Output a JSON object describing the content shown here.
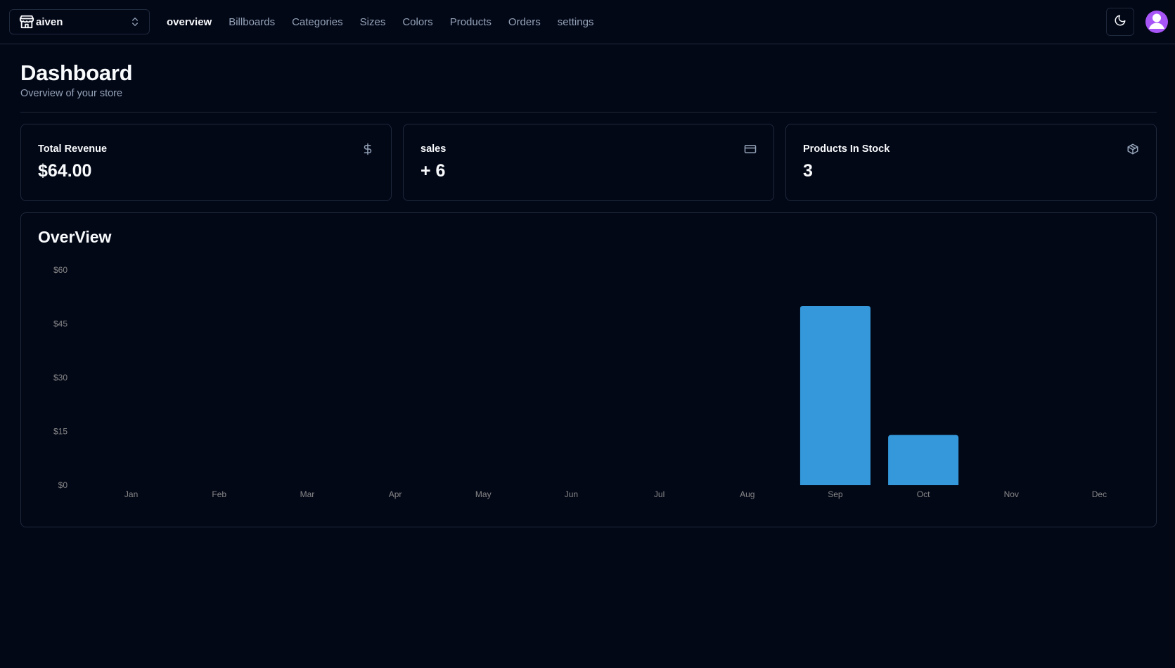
{
  "header": {
    "store_name": "aiven",
    "store_icon": "store-icon",
    "switcher_icon": "chevrons-up-down-icon",
    "nav": [
      {
        "label": "overview",
        "active": true
      },
      {
        "label": "Billboards",
        "active": false
      },
      {
        "label": "Categories",
        "active": false
      },
      {
        "label": "Sizes",
        "active": false
      },
      {
        "label": "Colors",
        "active": false
      },
      {
        "label": "Products",
        "active": false
      },
      {
        "label": "Orders",
        "active": false
      },
      {
        "label": "settings",
        "active": false
      }
    ],
    "theme_icon": "moon-icon",
    "avatar_icon": "user-avatar-icon"
  },
  "page": {
    "title": "Dashboard",
    "subtitle": "Overview of your store"
  },
  "stats": [
    {
      "label": "Total Revenue",
      "value": "$64.00",
      "icon": "dollar-sign-icon"
    },
    {
      "label": "sales",
      "value": "+ 6",
      "icon": "credit-card-icon"
    },
    {
      "label": "Products In Stock",
      "value": "3",
      "icon": "package-icon"
    }
  ],
  "overview": {
    "title": "OverView"
  },
  "colors": {
    "background": "#030817",
    "border": "#1e293b",
    "bar": "#3498db",
    "muted_text": "#94a3b8",
    "axis_text": "#888888",
    "avatar": "#a855f7"
  },
  "chart_data": {
    "type": "bar",
    "title": "OverView",
    "categories": [
      "Jan",
      "Feb",
      "Mar",
      "Apr",
      "May",
      "Jun",
      "Jul",
      "Aug",
      "Sep",
      "Oct",
      "Nov",
      "Dec"
    ],
    "values": [
      0,
      0,
      0,
      0,
      0,
      0,
      0,
      0,
      50,
      14,
      0,
      0
    ],
    "ylim": [
      0,
      60
    ],
    "yticks": [
      "$0",
      "$15",
      "$30",
      "$45",
      "$60"
    ],
    "ytick_values": [
      0,
      15,
      30,
      45,
      60
    ],
    "grid": false,
    "legend": "none",
    "xlabel": "",
    "ylabel": ""
  }
}
